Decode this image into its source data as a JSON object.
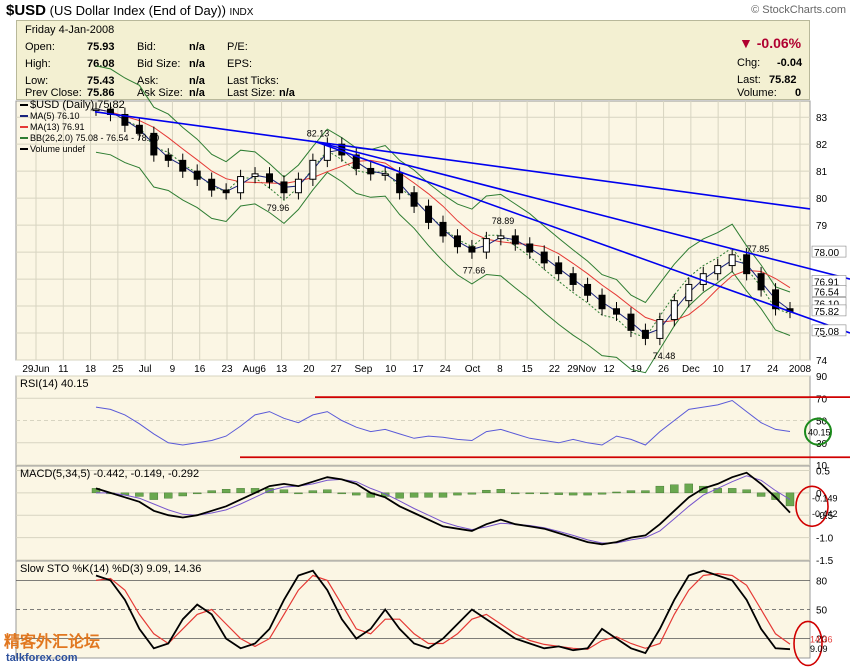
{
  "header": {
    "symbol": "$USD",
    "name": "(US Dollar Index (End of Day))",
    "exchange": "INDX",
    "brand": "© StockCharts.com"
  },
  "quote": {
    "date": "Friday   4-Jan-2008",
    "open_label": "Open:",
    "open": "75.93",
    "high_label": "High:",
    "high": "76.08",
    "low_label": "Low:",
    "low": "75.43",
    "prev_label": "Prev Close:",
    "prev": "75.86",
    "bid_label": "Bid:",
    "bid": "n/a",
    "bidsize_label": "Bid Size:",
    "bidsize": "n/a",
    "ask_label": "Ask:",
    "ask": "n/a",
    "asksize_label": "Ask Size:",
    "asksize": "n/a",
    "pe_label": "P/E:",
    "eps_label": "EPS:",
    "lastticks_label": "Last Ticks:",
    "lastsize_label": "Last Size:",
    "lastsize": "n/a",
    "chg_pct": "-0.06%",
    "chg_label": "Chg:",
    "chg": "-0.04",
    "last_label": "Last:",
    "last": "75.82",
    "vol_label": "Volume:",
    "vol": "0"
  },
  "colors": {
    "panel_bg": "#fbf6e4",
    "grid": "#d7d4c1",
    "bb": "#2e7d32",
    "ma5": "#1a237e",
    "ma13": "#e53935",
    "trend": "#0000ee",
    "rsi": "#5a5ad8",
    "red_line": "#d00000",
    "macd": "#000000",
    "signal": "#7755cc",
    "hist": "#6aa84f",
    "stok": "#000000",
    "stod": "#e53935"
  },
  "chart_data": [
    {
      "type": "candlestick",
      "legend": [
        "$USD (Daily) 75.82",
        "MA(5) 76.10",
        "MA(13) 76.91",
        "BB(26,2.0) 75.08 - 76.54 - 78.00",
        "Volume undef"
      ],
      "x_tick_labels": [
        "29Jun",
        "11",
        "18",
        "25",
        "Jul",
        "9",
        "16",
        "23",
        "Aug6",
        "13",
        "20",
        "27",
        "Sep",
        "10",
        "17",
        "24",
        "Oct",
        "8",
        "15",
        "22",
        "29Nov",
        "12",
        "19",
        "26",
        "Dec",
        "10",
        "17",
        "24",
        "2008"
      ],
      "ylim": [
        74,
        83.6
      ],
      "y_ticks": [
        74,
        75,
        76,
        77,
        78,
        79,
        80,
        81,
        82,
        83
      ],
      "annotations": [
        {
          "label": "82.13",
          "value": 82.13
        },
        {
          "label": "79.96",
          "value": 79.96
        },
        {
          "label": "78.89",
          "value": 78.89
        },
        {
          "label": "77.66",
          "value": 77.66
        },
        {
          "label": "74.48",
          "value": 74.48
        },
        {
          "label": "77.85",
          "value": 77.85
        }
      ],
      "right_labels": [
        "78.00",
        "76.91",
        "76.54",
        "76.10",
        "75.82",
        "75.08"
      ],
      "close": [
        83.3,
        83.1,
        82.7,
        82.4,
        81.6,
        81.4,
        81.0,
        80.7,
        80.3,
        80.2,
        80.8,
        80.9,
        80.6,
        80.2,
        80.7,
        81.4,
        82.0,
        81.6,
        81.1,
        80.9,
        80.9,
        80.2,
        79.7,
        79.1,
        78.6,
        78.2,
        78.0,
        78.5,
        78.6,
        78.3,
        78.0,
        77.6,
        77.2,
        76.8,
        76.4,
        75.9,
        75.7,
        75.1,
        74.8,
        75.5,
        76.2,
        76.8,
        77.2,
        77.5,
        77.9,
        77.2,
        76.6,
        75.9,
        75.8
      ],
      "series": [
        {
          "name": "MA(5)",
          "value": 76.1
        },
        {
          "name": "MA(13)",
          "value": 76.91
        },
        {
          "name": "BB(26,2.0)",
          "values": [
            75.08,
            76.54,
            78.0
          ]
        }
      ]
    },
    {
      "type": "line",
      "title": "RSI(14) 40.15",
      "ylim": [
        10,
        90
      ],
      "y_ticks": [
        10,
        30,
        50,
        70,
        90
      ],
      "right_labels": [
        "40.15"
      ],
      "values": [
        62,
        60,
        55,
        47,
        38,
        30,
        28,
        30,
        32,
        36,
        45,
        55,
        58,
        52,
        48,
        55,
        58,
        50,
        44,
        40,
        42,
        38,
        34,
        36,
        35,
        33,
        32,
        40,
        42,
        38,
        34,
        32,
        30,
        33,
        30,
        28,
        36,
        33,
        28,
        40,
        50,
        60,
        62,
        64,
        68,
        58,
        48,
        42,
        40.15
      ]
    },
    {
      "type": "line",
      "title": "MACD(5,34,5) -0.442, -0.149, -0.292",
      "ylim": [
        -1.5,
        0.6
      ],
      "y_ticks": [
        -1.5,
        -1.0,
        -0.5,
        0,
        0.5
      ],
      "y_tick_labels": [
        "-1.5",
        "-1.0",
        "-0.5",
        "0",
        "0.5"
      ],
      "right_labels": [
        "-0.149",
        "-0.442"
      ],
      "series": [
        {
          "name": "MACD",
          "values": [
            0.1,
            0.0,
            -0.1,
            -0.2,
            -0.4,
            -0.5,
            -0.55,
            -0.5,
            -0.4,
            -0.3,
            -0.15,
            0.0,
            0.15,
            0.2,
            0.15,
            0.25,
            0.35,
            0.3,
            0.2,
            0.0,
            -0.1,
            -0.3,
            -0.45,
            -0.6,
            -0.75,
            -0.8,
            -0.85,
            -0.7,
            -0.6,
            -0.7,
            -0.75,
            -0.8,
            -0.9,
            -1.0,
            -1.1,
            -1.15,
            -1.1,
            -1.0,
            -0.95,
            -0.7,
            -0.4,
            -0.1,
            0.1,
            0.2,
            0.35,
            0.45,
            0.2,
            -0.1,
            -0.442
          ]
        },
        {
          "name": "Signal",
          "values": [
            0.0,
            0.0,
            -0.05,
            -0.12,
            -0.25,
            -0.38,
            -0.48,
            -0.5,
            -0.45,
            -0.38,
            -0.25,
            -0.1,
            0.05,
            0.13,
            0.15,
            0.2,
            0.28,
            0.3,
            0.25,
            0.1,
            -0.02,
            -0.18,
            -0.35,
            -0.5,
            -0.65,
            -0.75,
            -0.82,
            -0.76,
            -0.68,
            -0.7,
            -0.73,
            -0.78,
            -0.86,
            -0.95,
            -1.05,
            -1.12,
            -1.12,
            -1.05,
            -1.0,
            -0.85,
            -0.58,
            -0.3,
            -0.05,
            0.1,
            0.25,
            0.38,
            0.28,
            0.05,
            -0.149
          ]
        },
        {
          "name": "Histogram",
          "values": [
            0.1,
            0.0,
            -0.05,
            -0.08,
            -0.15,
            -0.12,
            -0.07,
            0.0,
            0.05,
            0.08,
            0.1,
            0.1,
            0.1,
            0.07,
            0.0,
            0.05,
            0.07,
            0.0,
            -0.05,
            -0.1,
            -0.08,
            -0.12,
            -0.1,
            -0.1,
            -0.1,
            -0.05,
            -0.03,
            0.06,
            0.08,
            0.0,
            -0.02,
            -0.02,
            -0.04,
            -0.05,
            -0.05,
            -0.03,
            0.02,
            0.05,
            0.05,
            0.15,
            0.18,
            0.2,
            0.15,
            0.1,
            0.1,
            0.07,
            -0.08,
            -0.15,
            -0.292
          ]
        }
      ]
    },
    {
      "type": "line",
      "title": "Slow STO %K(14) %D(3) 9.09, 14.36",
      "ylim": [
        0,
        100
      ],
      "y_ticks": [
        20,
        50,
        80
      ],
      "right_labels": [
        "14.36",
        "9.09"
      ],
      "series": [
        {
          "name": "%K",
          "values": [
            85,
            80,
            60,
            30,
            10,
            15,
            40,
            55,
            45,
            20,
            10,
            15,
            30,
            60,
            85,
            90,
            70,
            40,
            20,
            30,
            50,
            30,
            15,
            10,
            20,
            35,
            50,
            40,
            30,
            20,
            15,
            10,
            12,
            8,
            10,
            30,
            20,
            10,
            5,
            30,
            60,
            85,
            90,
            85,
            80,
            60,
            30,
            10,
            9.09
          ]
        },
        {
          "name": "%D",
          "values": [
            80,
            82,
            70,
            45,
            25,
            15,
            30,
            45,
            50,
            35,
            20,
            12,
            20,
            45,
            70,
            85,
            80,
            55,
            30,
            25,
            40,
            40,
            25,
            15,
            15,
            25,
            40,
            45,
            35,
            25,
            18,
            14,
            12,
            10,
            9,
            18,
            22,
            15,
            10,
            15,
            45,
            70,
            85,
            87,
            85,
            75,
            50,
            25,
            14.36
          ]
        }
      ]
    }
  ],
  "watermark": {
    "cn": "精客外汇论坛",
    "en": "talkforex.com"
  }
}
